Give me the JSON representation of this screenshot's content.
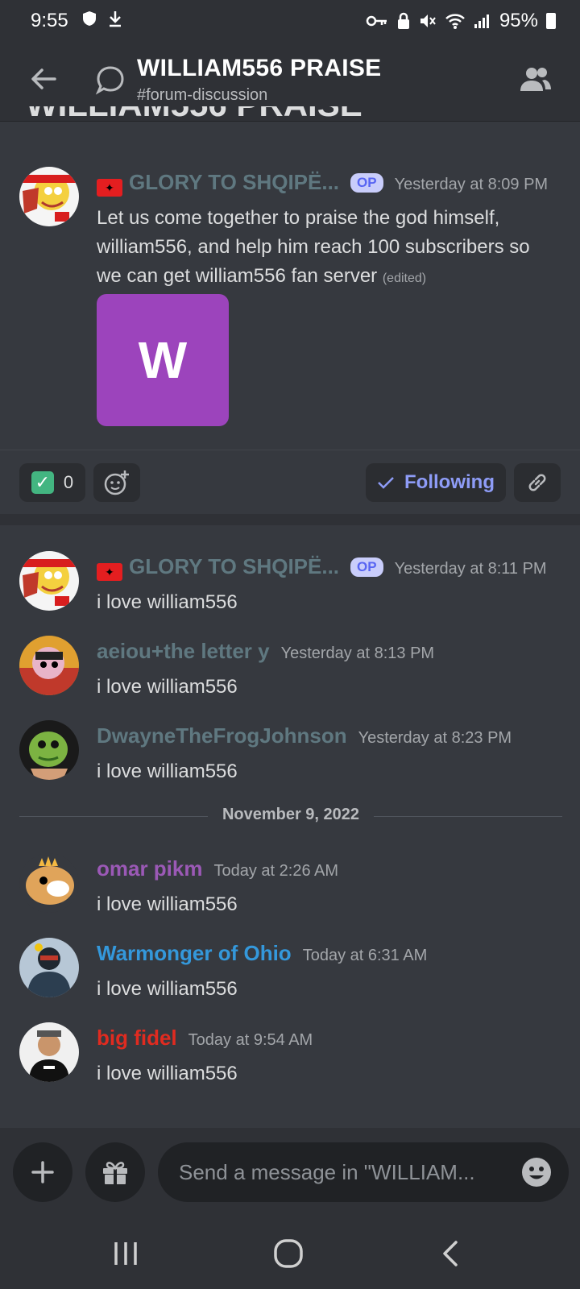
{
  "status_bar": {
    "time": "9:55",
    "battery": "95%"
  },
  "header": {
    "title": "WILLIAM556 PRAISE",
    "channel": "#forum-discussion"
  },
  "post_title_peek": "WILLIAM556 PRAISE",
  "original_post": {
    "author": "GLORY TO SHQIPË...",
    "badge": "OP",
    "timestamp": "Yesterday at 8:09 PM",
    "text": "Let us come together to praise the god himself, william556, and help him reach 100 subscribers so we can get william556 fan server",
    "edited": "(edited)",
    "attachment_letter": "W",
    "author_color": "#5f7880"
  },
  "reactions": {
    "check_count": "0",
    "following_label": "Following"
  },
  "messages": [
    {
      "author": "GLORY TO SHQIPË...",
      "badge": "OP",
      "timestamp": "Yesterday at 8:11 PM",
      "text": "i love william556",
      "color": "#5f7880"
    },
    {
      "author": "aeiou+the letter y",
      "timestamp": "Yesterday at 8:13 PM",
      "text": "i love william556",
      "color": "#5f7880"
    },
    {
      "author": "DwayneTheFrogJohnson",
      "timestamp": "Yesterday at 8:23 PM",
      "text": "i love william556",
      "color": "#5f7880"
    },
    {
      "author": "omar pikm",
      "timestamp": "Today at 2:26 AM",
      "text": "i love william556",
      "color": "#9b59b6"
    },
    {
      "author": "Warmonger of Ohio",
      "timestamp": "Today at 6:31 AM",
      "text": "i love william556",
      "color": "#3498db"
    },
    {
      "author": "big fidel",
      "timestamp": "Today at 9:54 AM",
      "text": "i love william556",
      "color": "#e02b20"
    }
  ],
  "date_separator": "November 9, 2022",
  "composer": {
    "placeholder": "Send a message in \"WILLIAM..."
  },
  "icons": [
    "back-arrow-icon",
    "thread-icon",
    "members-icon",
    "add-reaction-icon",
    "link-icon",
    "plus-icon",
    "gift-icon",
    "emoji-icon",
    "recents-icon",
    "home-icon",
    "nav-back-icon"
  ]
}
